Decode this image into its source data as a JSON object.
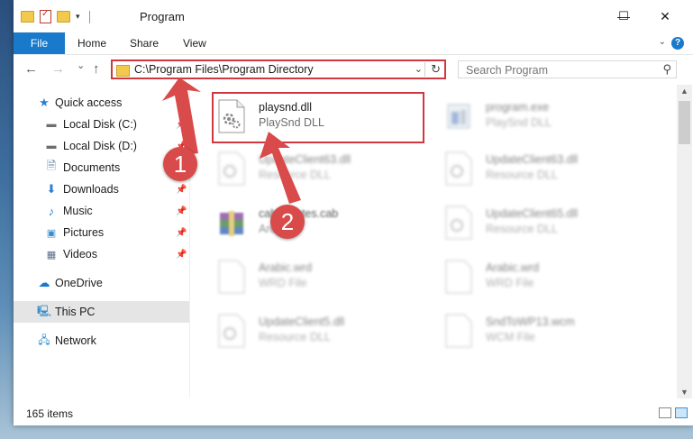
{
  "window": {
    "title": "Program",
    "controls": {
      "minimize": "—",
      "maximize": "☐",
      "close": "✕"
    }
  },
  "ribbon": {
    "tabs": [
      {
        "label": "File"
      },
      {
        "label": "Home"
      },
      {
        "label": "Share"
      },
      {
        "label": "View"
      }
    ]
  },
  "nav": {
    "back": "←",
    "forward": "→",
    "recent": "⌄",
    "up": "↑",
    "address": "C:\\Program Files\\Program Directory",
    "refresh": "↻",
    "search_placeholder": "Search Program"
  },
  "sidebar": {
    "items": [
      {
        "label": "Quick access",
        "icon": "star-icon"
      },
      {
        "label": "Local Disk (C:)",
        "icon": "drive-icon",
        "pinned": true
      },
      {
        "label": "Local Disk (D:)",
        "icon": "drive-icon",
        "pinned": true
      },
      {
        "label": "Documents",
        "icon": "documents-icon",
        "pinned": true
      },
      {
        "label": "Downloads",
        "icon": "download-icon",
        "pinned": true
      },
      {
        "label": "Music",
        "icon": "music-icon",
        "pinned": true
      },
      {
        "label": "Pictures",
        "icon": "pictures-icon",
        "pinned": true
      },
      {
        "label": "Videos",
        "icon": "video-icon",
        "pinned": true
      },
      {
        "label": "OneDrive",
        "icon": "cloud-icon"
      },
      {
        "label": "This PC",
        "icon": "computer-icon",
        "selected": true
      },
      {
        "label": "Network",
        "icon": "network-icon"
      }
    ]
  },
  "files": [
    {
      "name": "playsnd.dll",
      "type": "PlaySnd DLL",
      "icon": "dll-gear-icon",
      "highlighted": true
    },
    {
      "name": "program.exe",
      "type": "PlaySnd DLL",
      "icon": "exe-icon"
    },
    {
      "name": "UpdateClient63.dll",
      "type": "Resource DLL",
      "icon": "dll-icon"
    },
    {
      "name": "UpdateClient63.dll",
      "type": "Resource DLL",
      "icon": "dll-icon"
    },
    {
      "name": "cabupdates.cab",
      "type": "Archive",
      "icon": "archive-icon"
    },
    {
      "name": "UpdateClient65.dll",
      "type": "Resource DLL",
      "icon": "dll-icon"
    },
    {
      "name": "Arabic.wrd",
      "type": "WRD File",
      "icon": "file-icon"
    },
    {
      "name": "Arabic.wrd",
      "type": "WRD File",
      "icon": "file-icon"
    },
    {
      "name": "UpdateClient5.dll",
      "type": "Resource DLL",
      "icon": "dll-icon"
    },
    {
      "name": "SndToWP13.wcm",
      "type": "WCM File",
      "icon": "file-icon"
    }
  ],
  "status": {
    "item_count": "165 items"
  },
  "annotations": {
    "step1": "1",
    "step2": "2",
    "color": "#d94a4a"
  }
}
